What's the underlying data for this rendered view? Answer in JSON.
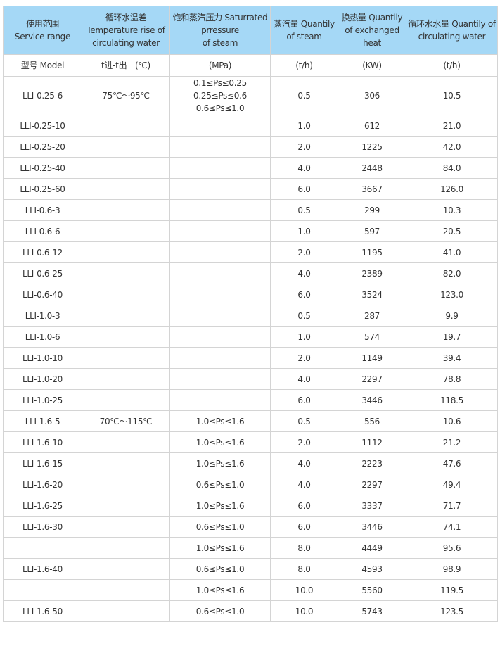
{
  "header": [
    "使用范围\nService range",
    "循环水温差\nTemperature rise of circulating water",
    "饱和蒸汽压力 Saturrated prressure\nof steam",
    "蒸汽量 Quantily\nof steam",
    "换热量 Quantily of exchanged heat",
    "循环水水量 Quantily of circulating water"
  ],
  "units": [
    "型号 Model",
    "t进-t出　(℃)",
    "(MPa)",
    "(t/h)",
    "(KW)",
    "(t/h)"
  ],
  "first_row": {
    "model": "LLI-0.25-6",
    "temp": "75℃～95℃",
    "pressure": [
      "0.1≤Ps≤0.25",
      "0.25≤Ps≤0.6",
      "0.6≤Ps≤1.0"
    ],
    "steam": "0.5",
    "heat": "306",
    "water": "10.5"
  },
  "rows": [
    [
      "LLI-0.25-10",
      "",
      "",
      "1.0",
      "612",
      "21.0"
    ],
    [
      "LLI-0.25-20",
      "",
      "",
      "2.0",
      "1225",
      "42.0"
    ],
    [
      "LLI-0.25-40",
      "",
      "",
      "4.0",
      "2448",
      "84.0"
    ],
    [
      "LLI-0.25-60",
      "",
      "",
      "6.0",
      "3667",
      "126.0"
    ],
    [
      "LLI-0.6-3",
      "",
      "",
      "0.5",
      "299",
      "10.3"
    ],
    [
      "LLI-0.6-6",
      "",
      "",
      "1.0",
      "597",
      "20.5"
    ],
    [
      "LLI-0.6-12",
      "",
      "",
      "2.0",
      "1195",
      "41.0"
    ],
    [
      "LLI-0.6-25",
      "",
      "",
      "4.0",
      "2389",
      "82.0"
    ],
    [
      "LLI-0.6-40",
      "",
      "",
      "6.0",
      "3524",
      "123.0"
    ],
    [
      "LLI-1.0-3",
      "",
      "",
      "0.5",
      "287",
      "9.9"
    ],
    [
      "LLI-1.0-6",
      "",
      "",
      "1.0",
      "574",
      "19.7"
    ],
    [
      "LLI-1.0-10",
      "",
      "",
      "2.0",
      "1149",
      "39.4"
    ],
    [
      "LLI-1.0-20",
      "",
      "",
      "4.0",
      "2297",
      "78.8"
    ],
    [
      "LLI-1.0-25",
      "",
      "",
      "6.0",
      "3446",
      "118.5"
    ],
    [
      "LLI-1.6-5",
      "70℃～115℃",
      "1.0≤Ps≤1.6",
      "0.5",
      "556",
      "10.6"
    ],
    [
      "LLI-1.6-10",
      "",
      "1.0≤Ps≤1.6",
      "2.0",
      "1112",
      "21.2"
    ],
    [
      "LLI-1.6-15",
      "",
      "1.0≤Ps≤1.6",
      "4.0",
      "2223",
      "47.6"
    ],
    [
      "LLI-1.6-20",
      "",
      "0.6≤Ps≤1.0",
      "4.0",
      "2297",
      "49.4"
    ],
    [
      "LLI-1.6-25",
      "",
      "1.0≤Ps≤1.6",
      "6.0",
      "3337",
      "71.7"
    ],
    [
      "LLI-1.6-30",
      "",
      "0.6≤Ps≤1.0",
      "6.0",
      "3446",
      "74.1"
    ],
    [
      "",
      "",
      "1.0≤Ps≤1.6",
      "8.0",
      "4449",
      "95.6"
    ],
    [
      "LLI-1.6-40",
      "",
      "0.6≤Ps≤1.0",
      "8.0",
      "4593",
      "98.9"
    ],
    [
      "",
      "",
      "1.0≤Ps≤1.6",
      "10.0",
      "5560",
      "119.5"
    ],
    [
      "LLI-1.6-50",
      "",
      "0.6≤Ps≤1.0",
      "10.0",
      "5743",
      "123.5"
    ]
  ],
  "colors": {
    "header_bg": "#a5d8f6",
    "border": "#d4d4d4",
    "text": "#333333"
  }
}
